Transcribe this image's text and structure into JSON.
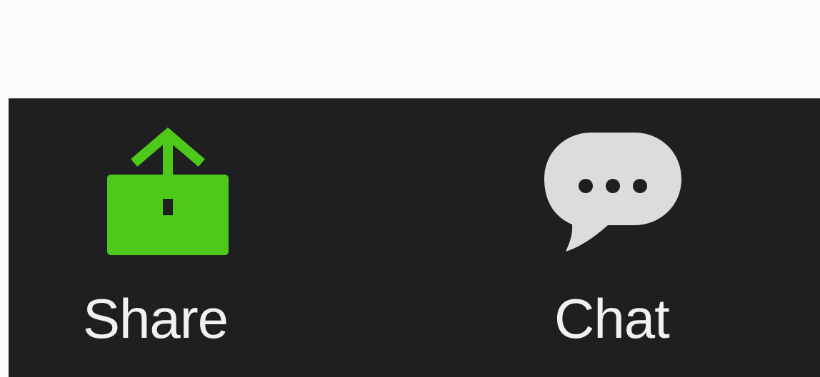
{
  "toolbar": {
    "share": {
      "label": "Share",
      "icon": "share-screen-icon",
      "icon_color": "#4cc919"
    },
    "chat": {
      "label": "Chat",
      "icon": "chat-bubble-icon",
      "icon_color": "#dcdcdc"
    },
    "background_color": "#1f1f21",
    "label_color": "#f1f1f1"
  },
  "page": {
    "top_background_color": "#fbfbfb"
  }
}
